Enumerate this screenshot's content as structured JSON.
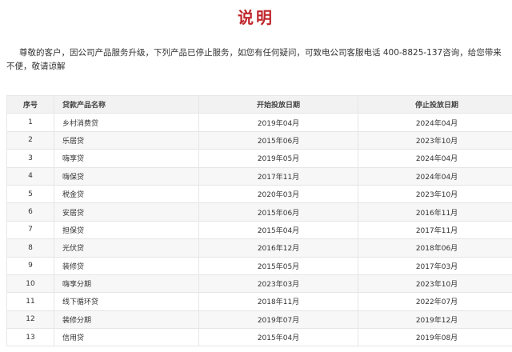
{
  "title": "说明",
  "notice": "尊敬的客户，因公司产品服务升级，下列产品已停止服务，如您有任何疑问，可致电公司客服电话 400-8825-137咨询，给您带来不便，敬请谅解",
  "table": {
    "headers": {
      "no": "序号",
      "name": "贷款产品名称",
      "start": "开始投放日期",
      "end": "停止投放日期"
    },
    "rows": [
      {
        "no": "1",
        "name": "乡村消费贷",
        "start": "2019年04月",
        "end": "2024年04月"
      },
      {
        "no": "2",
        "name": "乐居贷",
        "start": "2015年06月",
        "end": "2023年10月"
      },
      {
        "no": "3",
        "name": "嗨享贷",
        "start": "2019年05月",
        "end": "2024年04月"
      },
      {
        "no": "4",
        "name": "嗨保贷",
        "start": "2017年11月",
        "end": "2024年04月"
      },
      {
        "no": "5",
        "name": "税金贷",
        "start": "2020年03月",
        "end": "2023年10月"
      },
      {
        "no": "6",
        "name": "安居贷",
        "start": "2015年06月",
        "end": "2016年11月"
      },
      {
        "no": "7",
        "name": "担保贷",
        "start": "2015年04月",
        "end": "2017年11月"
      },
      {
        "no": "8",
        "name": "光伏贷",
        "start": "2016年12月",
        "end": "2018年06月"
      },
      {
        "no": "9",
        "name": "装修贷",
        "start": "2015年05月",
        "end": "2017年03月"
      },
      {
        "no": "10",
        "name": "嗨享分期",
        "start": "2023年03月",
        "end": "2023年10月"
      },
      {
        "no": "11",
        "name": "线下循环贷",
        "start": "2018年11月",
        "end": "2022年07月"
      },
      {
        "no": "12",
        "name": "装修分期",
        "start": "2019年07月",
        "end": "2019年12月"
      },
      {
        "no": "13",
        "name": "信用贷",
        "start": "2015年04月",
        "end": "2019年08月"
      }
    ]
  },
  "colors": {
    "title": "#c0272d",
    "header_bg": "#f2f2f2",
    "row_alt_bg": "#f7f7f7",
    "border": "#e6e6e6"
  }
}
